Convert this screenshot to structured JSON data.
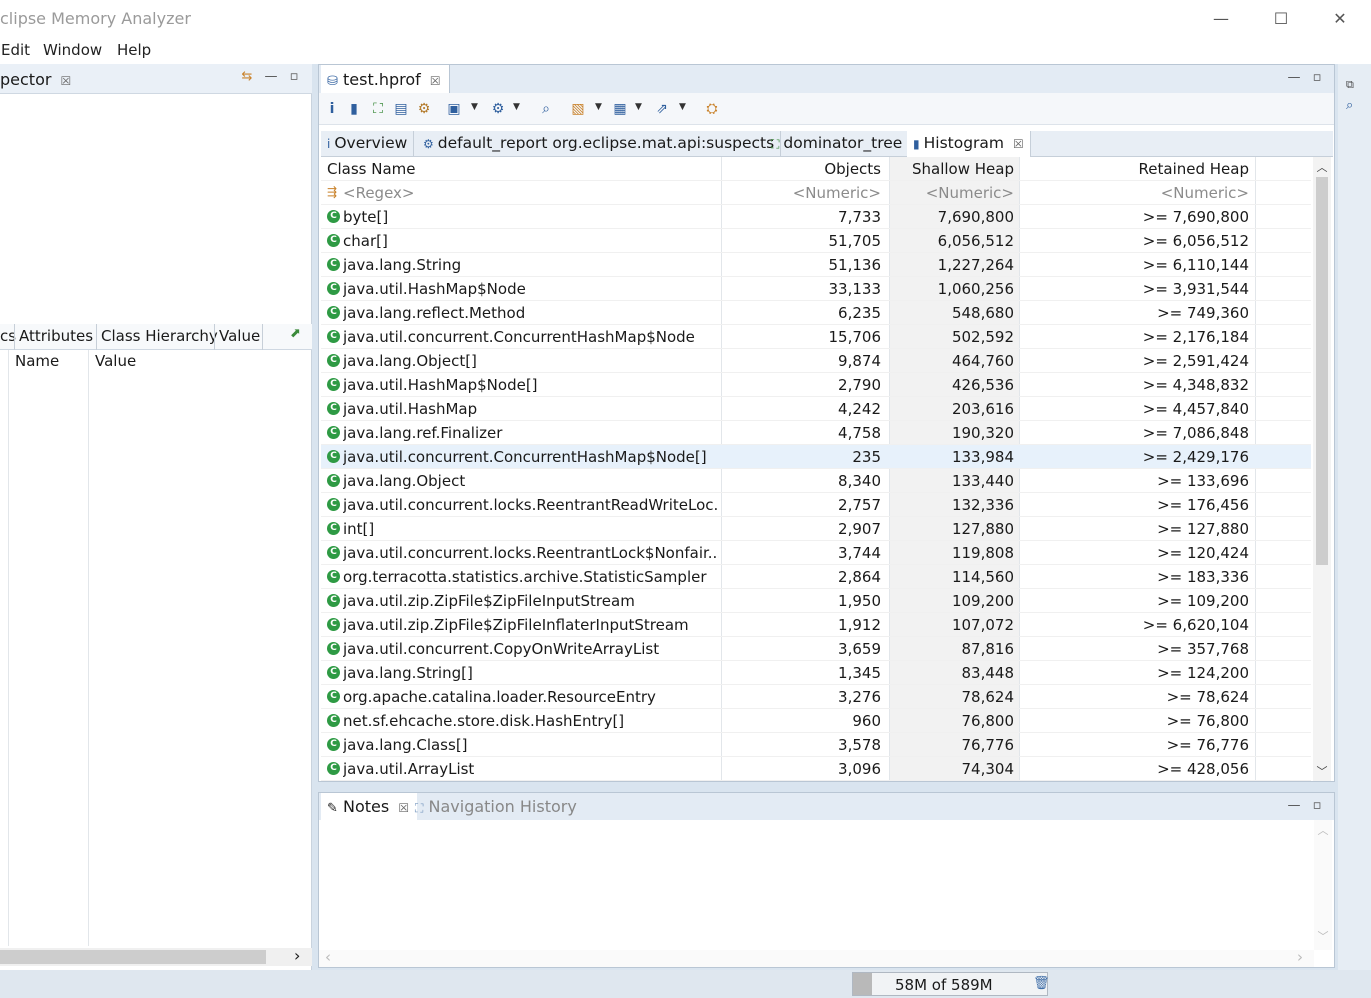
{
  "window": {
    "title": "clipse Memory Analyzer",
    "minimize_icon": "minimize-icon",
    "maximize_icon": "maximize-icon",
    "close_icon": "close-icon",
    "min_glyph": "—",
    "max_glyph": "☐",
    "close_glyph": "✕"
  },
  "menu": [
    "Edit",
    "Window",
    "Help"
  ],
  "inspector": {
    "tab_label": "pector",
    "close": "☒",
    "tabs": [
      "cs",
      "Attributes",
      "Class Hierarchy",
      "Value"
    ],
    "columns": [
      "Name",
      "Value"
    ],
    "pin_glyph": "⬈",
    "scroll_right": "›"
  },
  "editor": {
    "file_tab": "test.hprof",
    "close": "☒",
    "sub_tabs": [
      {
        "icon": "i",
        "label": "Overview"
      },
      {
        "icon": "⚙",
        "label": "default_report  org.eclipse.mat.api:suspects"
      },
      {
        "icon": "⛶",
        "label": "dominator_tree"
      },
      {
        "icon": "▮",
        "label": "Histogram"
      }
    ],
    "histogram_close": "☒"
  },
  "histogram": {
    "headers": {
      "name": "Class Name",
      "objects": "Objects",
      "shallow": "Shallow Heap",
      "retained": "Retained Heap"
    },
    "filters": {
      "name": "<Regex>",
      "objects": "<Numeric>",
      "shallow": "<Numeric>",
      "retained": "<Numeric>"
    },
    "rows": [
      {
        "name": "byte[]",
        "objects": "7,733",
        "shallow": "7,690,800",
        "retained": ">= 7,690,800"
      },
      {
        "name": "char[]",
        "objects": "51,705",
        "shallow": "6,056,512",
        "retained": ">= 6,056,512"
      },
      {
        "name": "java.lang.String",
        "objects": "51,136",
        "shallow": "1,227,264",
        "retained": ">= 6,110,144"
      },
      {
        "name": "java.util.HashMap$Node",
        "objects": "33,133",
        "shallow": "1,060,256",
        "retained": ">= 3,931,544"
      },
      {
        "name": "java.lang.reflect.Method",
        "objects": "6,235",
        "shallow": "548,680",
        "retained": ">= 749,360"
      },
      {
        "name": "java.util.concurrent.ConcurrentHashMap$Node",
        "objects": "15,706",
        "shallow": "502,592",
        "retained": ">= 2,176,184"
      },
      {
        "name": "java.lang.Object[]",
        "objects": "9,874",
        "shallow": "464,760",
        "retained": ">= 2,591,424"
      },
      {
        "name": "java.util.HashMap$Node[]",
        "objects": "2,790",
        "shallow": "426,536",
        "retained": ">= 4,348,832"
      },
      {
        "name": "java.util.HashMap",
        "objects": "4,242",
        "shallow": "203,616",
        "retained": ">= 4,457,840"
      },
      {
        "name": "java.lang.ref.Finalizer",
        "objects": "4,758",
        "shallow": "190,320",
        "retained": ">= 7,086,848"
      },
      {
        "name": "java.util.concurrent.ConcurrentHashMap$Node[]",
        "objects": "235",
        "shallow": "133,984",
        "retained": ">= 2,429,176"
      },
      {
        "name": "java.lang.Object",
        "objects": "8,340",
        "shallow": "133,440",
        "retained": ">= 133,696"
      },
      {
        "name": "java.util.concurrent.locks.ReentrantReadWriteLoc...",
        "objects": "2,757",
        "shallow": "132,336",
        "retained": ">= 176,456"
      },
      {
        "name": "int[]",
        "objects": "2,907",
        "shallow": "127,880",
        "retained": ">= 127,880"
      },
      {
        "name": "java.util.concurrent.locks.ReentrantLock$Nonfair...",
        "objects": "3,744",
        "shallow": "119,808",
        "retained": ">= 120,424"
      },
      {
        "name": "org.terracotta.statistics.archive.StatisticSampler",
        "objects": "2,864",
        "shallow": "114,560",
        "retained": ">= 183,336"
      },
      {
        "name": "java.util.zip.ZipFile$ZipFileInputStream",
        "objects": "1,950",
        "shallow": "109,200",
        "retained": ">= 109,200"
      },
      {
        "name": "java.util.zip.ZipFile$ZipFileInflaterInputStream",
        "objects": "1,912",
        "shallow": "107,072",
        "retained": ">= 6,620,104"
      },
      {
        "name": "java.util.concurrent.CopyOnWriteArrayList",
        "objects": "3,659",
        "shallow": "87,816",
        "retained": ">= 357,768"
      },
      {
        "name": "java.lang.String[]",
        "objects": "1,345",
        "shallow": "83,448",
        "retained": ">= 124,200"
      },
      {
        "name": "org.apache.catalina.loader.ResourceEntry",
        "objects": "3,276",
        "shallow": "78,624",
        "retained": ">= 78,624"
      },
      {
        "name": "net.sf.ehcache.store.disk.HashEntry[]",
        "objects": "960",
        "shallow": "76,800",
        "retained": ">= 76,800"
      },
      {
        "name": "java.lang.Class[]",
        "objects": "3,578",
        "shallow": "76,776",
        "retained": ">= 76,776"
      },
      {
        "name": "java.util.ArrayList",
        "objects": "3,096",
        "shallow": "74,304",
        "retained": ">= 428,056"
      }
    ],
    "selected_index": 10,
    "class_icon_glyph": "C"
  },
  "notes": {
    "tab_label": "Notes",
    "close": "☒",
    "nav_history_label": "Navigation History"
  },
  "status": {
    "heap": "58M of 589M",
    "heap_used_fraction": 0.098,
    "gc_icon": "trash-icon",
    "gc_glyph": "🗑"
  },
  "colors": {
    "class_icon": "#2e9a44",
    "selection": "#e7f1fb",
    "accent": "#2f5f9e"
  }
}
